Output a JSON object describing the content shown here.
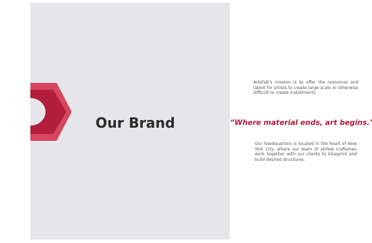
{
  "slide": {
    "title": "Our Brand",
    "mission_text": "ArtsFab’s mission is to offer the resources and talent for artists to create large-scale or otherwise difficult to create installments.",
    "quote": "“Where material ends, art begins.”",
    "hq_text": "Our headquarters is located in the heart of New York City, where our team of skilled craftsmen work together with our clients to blueprint and build desired structures."
  },
  "colors": {
    "accent_dark": "#b11e3a",
    "accent_light": "#d6465e",
    "panel_bg": "#e6e6ea"
  },
  "icons": {
    "logo": "hexagon-arrow-logo"
  }
}
